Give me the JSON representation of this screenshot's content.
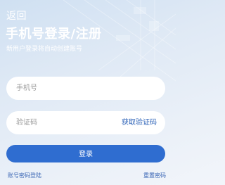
{
  "header": {
    "back_label": "返回",
    "title": "手机号登录/注册",
    "subtitle": "新用户登录将自动创建账号"
  },
  "form": {
    "phone_placeholder": "手机号",
    "code_placeholder": "验证码",
    "get_code_label": "获取验证码",
    "login_label": "登录"
  },
  "footer": {
    "password_login_label": "账号密码登陆",
    "reset_password_label": "重置密码"
  },
  "colors": {
    "accent": "#2f6dd0",
    "link": "#2f64b8"
  }
}
